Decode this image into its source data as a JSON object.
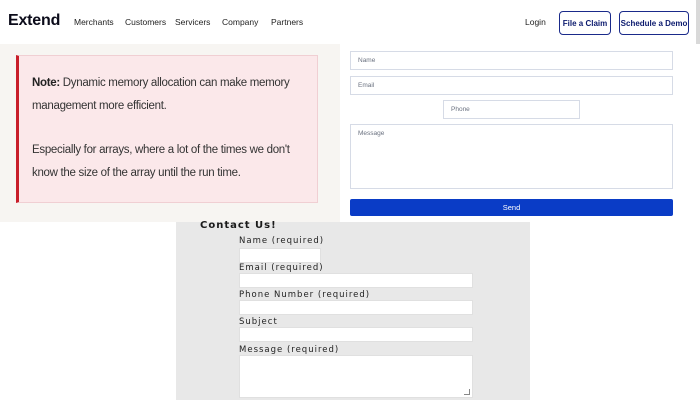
{
  "header": {
    "logo": "Extend",
    "nav": [
      "Merchants",
      "Customers",
      "Servicers",
      "Company",
      "Partners"
    ],
    "login": "Login",
    "file_claim": "File a Claim",
    "schedule_demo": "Schedule a Demo"
  },
  "note": {
    "label": "Note:",
    "text1": " Dynamic memory allocation can make memory management more efficient.",
    "text2": "Especially for arrays, where a lot of the times we don't know the size of the array until the run time.",
    "accent_color": "#c81e2a"
  },
  "form": {
    "name_placeholder": "Name",
    "email_placeholder": "Email",
    "phone_placeholder": "Phone",
    "message_placeholder": "Message",
    "send_label": "Send",
    "send_color": "#0a3cc6"
  },
  "contact": {
    "title": "Contact Us!",
    "name_label": "Name (required)",
    "email_label": "Email (required)",
    "phone_label": "Phone Number (required)",
    "subject_label": "Subject",
    "message_label": "Message (required)"
  }
}
